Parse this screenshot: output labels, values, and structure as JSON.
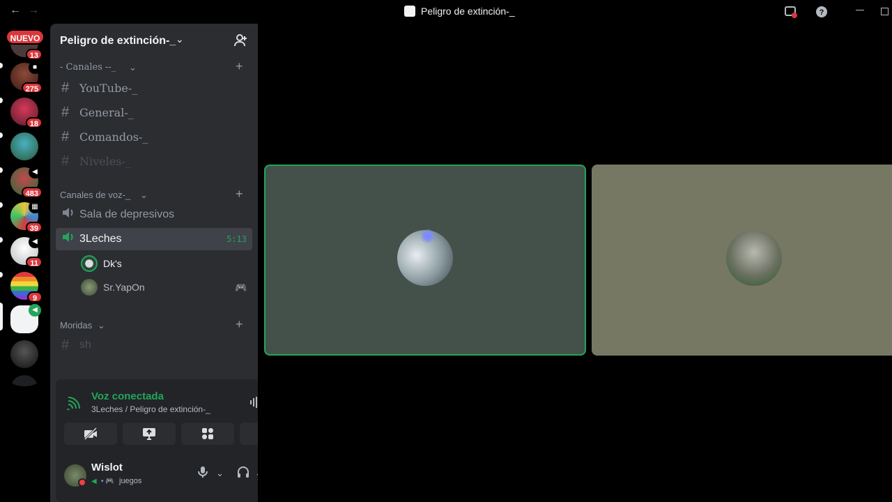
{
  "window": {
    "title": "Peligro de extinción-_",
    "back_icon": "←",
    "forward_icon": "→"
  },
  "guilds": {
    "new_label": "NUEVO",
    "items": [
      {
        "badge": "13"
      },
      {
        "badge": "275"
      },
      {
        "badge": "18"
      },
      {
        "badge": ""
      },
      {
        "badge": "483"
      },
      {
        "badge": "39"
      },
      {
        "badge": "11"
      },
      {
        "badge": "9"
      },
      {
        "badge": ""
      },
      {
        "badge": ""
      }
    ]
  },
  "server": {
    "name": "Peligro de extinción-_",
    "categories": [
      {
        "label": "- Canales --_"
      },
      {
        "label": "Canales de voz-_"
      },
      {
        "label": "Moridas"
      }
    ],
    "text_channels": [
      "YouTube-_",
      "General-_",
      "Comandos-_",
      "Niveles-_"
    ],
    "voice_channels": [
      {
        "name": "Sala de depresivos"
      },
      {
        "name": "3Leches",
        "time": "5:13"
      }
    ],
    "voice_users": [
      "Dk's",
      "Sr.YapOn"
    ],
    "other_channels": [
      "sh"
    ]
  },
  "panel": {
    "voice_status": "Voz conectada",
    "voice_sub": "3Leches / Peligro de extinción-_",
    "user_name": "Wislot",
    "user_status": "juegos"
  },
  "colors": {
    "accent_green": "#23a55a",
    "badge_red": "#da373c",
    "tile1": "#43514a",
    "tile2": "#767864"
  }
}
